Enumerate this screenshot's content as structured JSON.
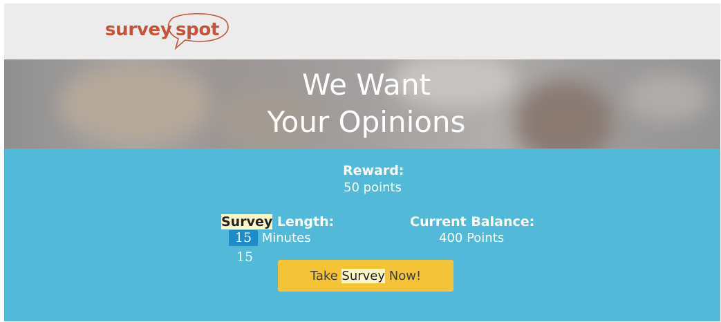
{
  "brand": {
    "logo_part1": "survey",
    "logo_part2": "spot",
    "logo_color": "#c4533a"
  },
  "hero": {
    "line1": "We Want",
    "line2": "Your Opinions"
  },
  "reward": {
    "label": "Reward:",
    "value": "50 points"
  },
  "survey_length": {
    "label_highlight": "Survey",
    "label_rest": " Length:",
    "minutes_highlight": "15",
    "minutes_unit": " Minutes",
    "overlay_number": "15"
  },
  "balance": {
    "label": "Current Balance:",
    "value": "400 Points"
  },
  "cta": {
    "text_before": "Take ",
    "text_highlight": "Survey",
    "text_after": " Now!"
  },
  "colors": {
    "panel_bg": "#52bad8",
    "cta_bg": "#f5c338",
    "topbar_bg": "#ececec",
    "highlight_yellow": "#fdf7c8",
    "highlight_blue": "#1e8cc8"
  }
}
